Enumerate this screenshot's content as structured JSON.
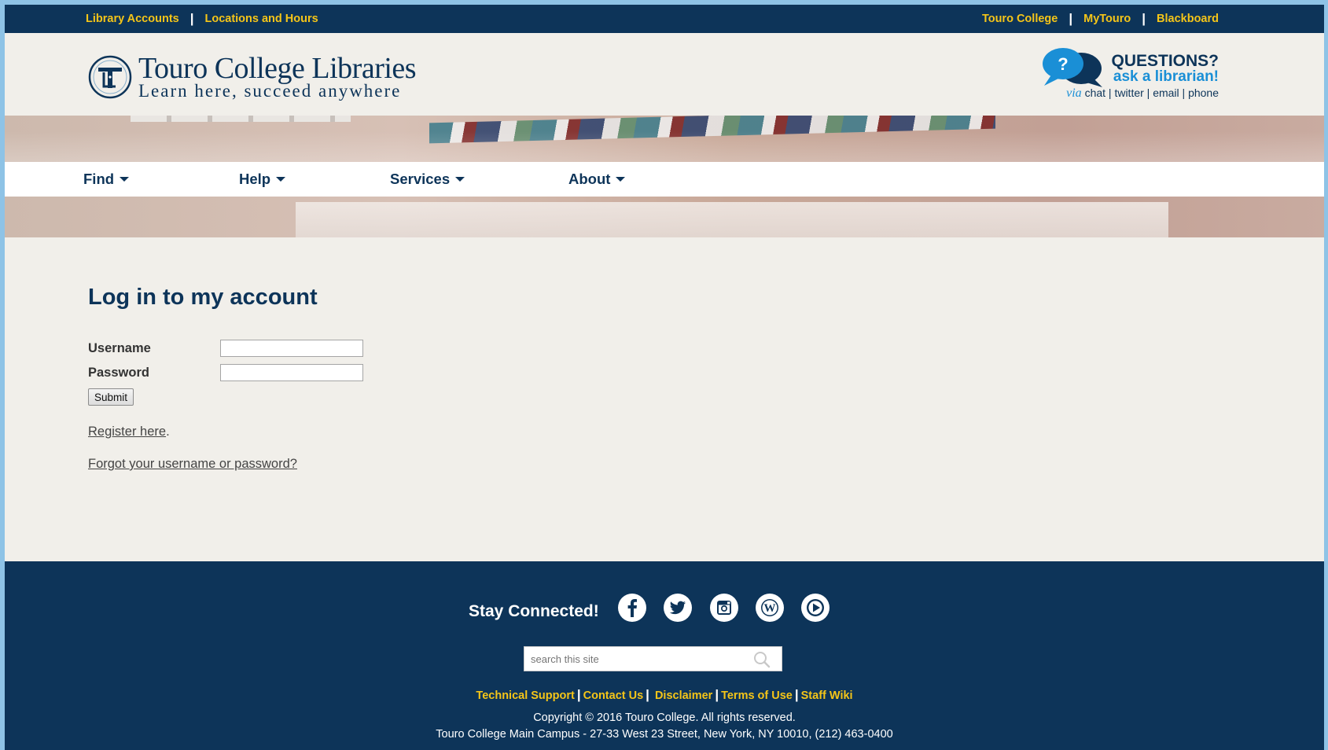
{
  "topbar": {
    "left_links": [
      "Library Accounts",
      "Locations and Hours"
    ],
    "right_links": [
      "Touro College",
      "MyTouro",
      "Blackboard"
    ]
  },
  "header": {
    "logo_title": "Touro College Libraries",
    "logo_tagline": "Learn here, succeed anywhere",
    "ask": {
      "line1": "QUESTIONS?",
      "line2": "ask a librarian!",
      "via": "via",
      "channels": "chat | twitter | email | phone"
    }
  },
  "nav": {
    "items": [
      "Find",
      "Help",
      "Services",
      "About"
    ]
  },
  "login": {
    "title": "Log in to my account",
    "username_label": "Username",
    "password_label": "Password",
    "username_value": "",
    "password_value": "",
    "submit_label": "Submit",
    "register_link": "Register here",
    "register_suffix": ".",
    "forgot_link": "Forgot your username or password?"
  },
  "footer": {
    "stay_connected": "Stay Connected!",
    "social_icons": [
      "facebook-icon",
      "twitter-icon",
      "instagram-icon",
      "wordpress-icon",
      "youtube-icon"
    ],
    "search_placeholder": "search this site",
    "links": [
      "Technical Support",
      "Contact Us",
      "Disclaimer",
      "Terms of Use",
      "Staff Wiki"
    ],
    "copyright": "Copyright © 2016 Touro College. All rights reserved.",
    "address": "Touro College Main Campus - 27-33 West 23 Street, New York, NY 10010, (212) 463-0400"
  },
  "colors": {
    "navy": "#0d3459",
    "gold": "#f5c518",
    "sky": "#1a8fd6",
    "page_bg": "#f1efea"
  }
}
